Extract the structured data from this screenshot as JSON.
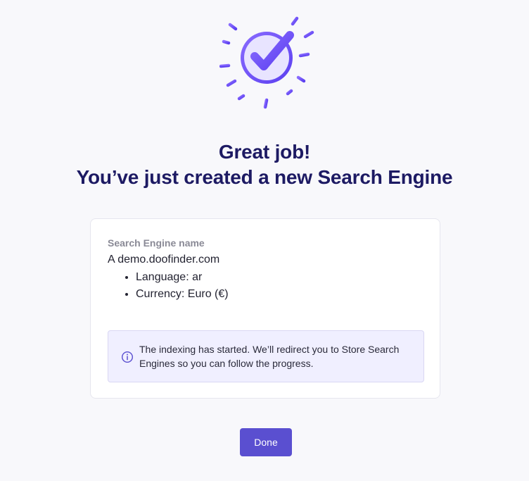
{
  "header": {
    "icon": "check-burst-icon",
    "title_line1": "Great job!",
    "title_line2": "You’ve just created a new Search Engine"
  },
  "card": {
    "field_label": "Search Engine name",
    "engine_name": "A demo.doofinder.com",
    "details": [
      "Language: ar",
      "Currency: Euro (€)"
    ],
    "notice": {
      "icon": "info-icon",
      "text": "The indexing has started. We’ll redirect you to Store Search Engines so you can follow the progress."
    }
  },
  "actions": {
    "done_label": "Done"
  },
  "colors": {
    "accent": "#5a4fd0",
    "heading": "#1d1a63",
    "notice_bg": "#f0efff"
  }
}
